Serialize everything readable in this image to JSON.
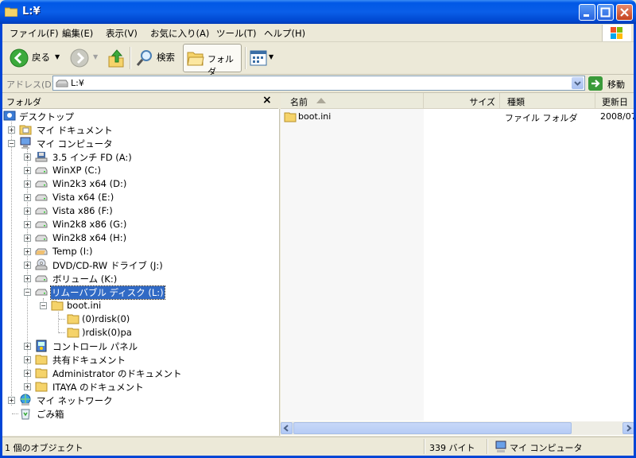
{
  "window": {
    "title": "L:¥"
  },
  "menu": [
    "ファイル(F)",
    "編集(E)",
    "表示(V)",
    "お気に入り(A)",
    "ツール(T)",
    "ヘルプ(H)"
  ],
  "toolbar": {
    "back": "戻る",
    "search": "検索",
    "folders": "フォルダ"
  },
  "address": {
    "label": "アドレス(D)",
    "value": "L:¥",
    "go": "移動"
  },
  "folder_pane": {
    "title": "フォルダ",
    "close": "×"
  },
  "tree": {
    "desktop": "デスクトップ",
    "mydocs": "マイ ドキュメント",
    "mycomputer": "マイ コンピュータ",
    "drives": [
      "3.5 インチ FD (A:)",
      "WinXP (C:)",
      "Win2k3 x64 (D:)",
      "Vista x64 (E:)",
      "Vista x86 (F:)",
      "Win2k8 x86 (G:)",
      "Win2k8 x64 (H:)",
      "Temp (I:)",
      "DVD/CD-RW ドライブ (J:)",
      "ボリューム (K:)",
      "リムーバブル ディスク (L:)"
    ],
    "boot": "boot.ini",
    "sub1": "(0)rdisk(0)",
    "sub2": ")rdisk(0)pa",
    "control": "コントロール パネル",
    "shared": "共有ドキュメント",
    "admin": "Administrator のドキュメント",
    "itaya": "ITAYA のドキュメント",
    "network": "マイ ネットワーク",
    "recycle": "ごみ箱"
  },
  "columns": {
    "name": "名前",
    "size": "サイズ",
    "type": "種類",
    "modified": "更新日"
  },
  "files": [
    {
      "name": "boot.ini",
      "size": "",
      "type": "ファイル フォルダ",
      "modified": "2008/07"
    }
  ],
  "status": {
    "objects": "1 個のオブジェクト",
    "bytes": "339 バイト",
    "location": "マイ コンピュータ"
  }
}
